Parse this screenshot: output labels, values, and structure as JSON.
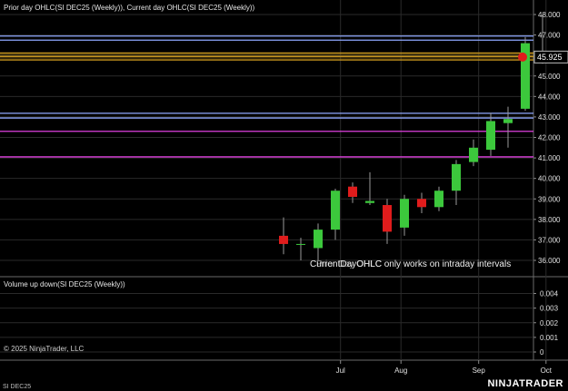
{
  "chart_data": {
    "type": "candlestick",
    "price_panel_title": "Prior day OHLC(SI DEC25 (Weekly)), Current day OHLC(SI DEC25 (Weekly))",
    "volume_panel_title": "Volume up down(SI DEC25 (Weekly))",
    "notice": "CurrentDayOHLC only works on intraday intervals",
    "notice_overlap": "Prior Day OHLC",
    "copyright": "© 2025 NinjaTrader, LLC",
    "instrument": "SI DEC25",
    "brand": "NINJATRADER",
    "current_price_label": "45.925",
    "price_axis": {
      "min": 35.5,
      "max": 48.0,
      "ticks": [
        36.0,
        37.0,
        38.0,
        39.0,
        40.0,
        41.0,
        42.0,
        43.0,
        44.0,
        45.0,
        46.0,
        47.0,
        48.0
      ],
      "tick_labels": [
        "36.000",
        "37.000",
        "38.000",
        "39.000",
        "40.000",
        "41.000",
        "42.000",
        "43.000",
        "44.000",
        "45.000",
        "46.000",
        "47.000",
        "48.000"
      ]
    },
    "volume_axis": {
      "min": 0,
      "max": 0.0048,
      "ticks": [
        0,
        0.001,
        0.002,
        0.003,
        0.004
      ],
      "tick_labels": [
        "0",
        "0.001",
        "0.002",
        "0.003",
        "0.004"
      ]
    },
    "x_axis": {
      "labels": [
        "Jul",
        "Aug",
        "Sep",
        "Oct"
      ],
      "label_at_index": [
        3.3,
        6.8,
        11.3,
        15.2
      ]
    },
    "candles": [
      {
        "o": 37.2,
        "h": 38.1,
        "l": 36.3,
        "c": 36.8
      },
      {
        "o": 36.8,
        "h": 37.1,
        "l": 36.0,
        "c": 36.8
      },
      {
        "o": 36.6,
        "h": 37.8,
        "l": 36.0,
        "c": 37.5
      },
      {
        "o": 37.5,
        "h": 39.5,
        "l": 37.0,
        "c": 39.4
      },
      {
        "o": 39.6,
        "h": 39.8,
        "l": 38.8,
        "c": 39.1
      },
      {
        "o": 38.8,
        "h": 40.3,
        "l": 38.7,
        "c": 38.9
      },
      {
        "o": 38.7,
        "h": 39.0,
        "l": 36.8,
        "c": 37.4
      },
      {
        "o": 37.6,
        "h": 39.2,
        "l": 37.2,
        "c": 39.0
      },
      {
        "o": 39.0,
        "h": 39.3,
        "l": 38.3,
        "c": 38.6
      },
      {
        "o": 38.6,
        "h": 39.6,
        "l": 38.4,
        "c": 39.4
      },
      {
        "o": 39.4,
        "h": 40.9,
        "l": 38.7,
        "c": 40.7
      },
      {
        "o": 40.8,
        "h": 41.9,
        "l": 40.6,
        "c": 41.5
      },
      {
        "o": 41.4,
        "h": 43.2,
        "l": 41.1,
        "c": 42.8
      },
      {
        "o": 42.7,
        "h": 43.5,
        "l": 41.5,
        "c": 42.9
      },
      {
        "o": 43.4,
        "h": 46.9,
        "l": 43.3,
        "c": 46.6
      },
      {
        "o": 45.8,
        "h": 48.0,
        "l": 45.6,
        "c": 46.0
      }
    ],
    "levels": [
      {
        "value": 46.95,
        "color": "#8fa8ff"
      },
      {
        "value": 46.75,
        "color": "#8fa8ff"
      },
      {
        "value": 46.12,
        "color": "#c8961e"
      },
      {
        "value": 45.95,
        "color": "#c8961e"
      },
      {
        "value": 45.78,
        "color": "#c8961e"
      },
      {
        "value": 43.18,
        "color": "#8fa8ff"
      },
      {
        "value": 42.95,
        "color": "#8fa8ff"
      },
      {
        "value": 42.3,
        "color": "#e040e0"
      },
      {
        "value": 41.05,
        "color": "#e040e0"
      }
    ],
    "colors": {
      "up": "#3cc83c",
      "down": "#e01c1c",
      "background": "#000000",
      "grid": "#2a2a2a",
      "axis_text": "#e0e0e0",
      "current_price": "#e01c1c"
    }
  }
}
